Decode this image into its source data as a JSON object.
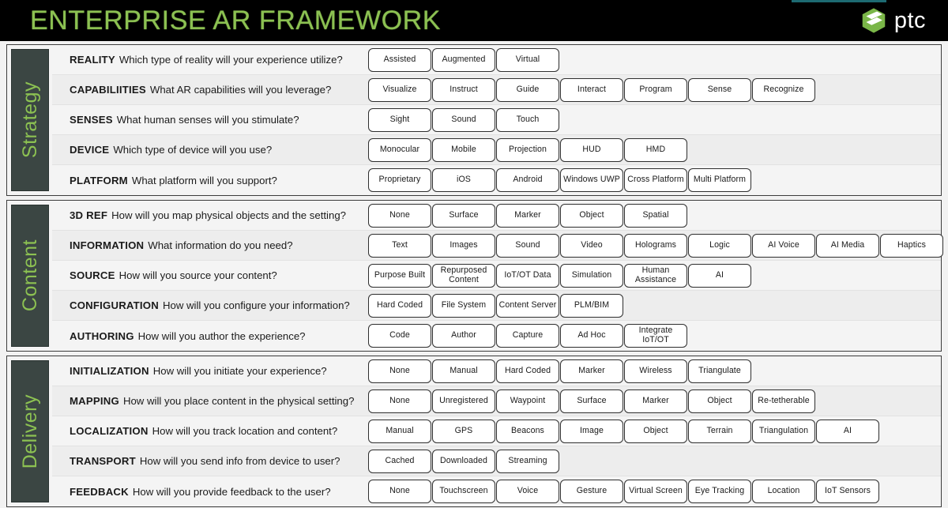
{
  "header": {
    "title": "ENTERPRISE AR FRAMEWORK",
    "brand_text": "ptc",
    "brand_icon": "ptc-hexagon-logo",
    "accent_green": "#8cc152",
    "accent_teal": "#1d6a72",
    "background": "#000000"
  },
  "sections": [
    {
      "label": "Strategy",
      "rows": [
        {
          "term": "REALITY",
          "question": "Which type of reality will your experience utilize?",
          "options": [
            "Assisted",
            "Augmented",
            "Virtual"
          ]
        },
        {
          "term": "CAPABILIITIES",
          "question": "What AR capabilities will you leverage?",
          "options": [
            "Visualize",
            "Instruct",
            "Guide",
            "Interact",
            "Program",
            "Sense",
            "Recognize"
          ]
        },
        {
          "term": "SENSES",
          "question": "What human senses will you stimulate?",
          "options": [
            "Sight",
            "Sound",
            "Touch"
          ]
        },
        {
          "term": "DEVICE",
          "question": "Which type of device will you use?",
          "options": [
            "Monocular",
            "Mobile",
            "Projection",
            "HUD",
            "HMD"
          ]
        },
        {
          "term": "PLATFORM",
          "question": "What platform will you support?",
          "options": [
            "Proprietary",
            "iOS",
            "Android",
            "Windows UWP",
            "Cross Platform",
            "Multi Platform"
          ]
        }
      ]
    },
    {
      "label": "Content",
      "rows": [
        {
          "term": "3D REF",
          "question": "How will you map physical objects and the setting?",
          "options": [
            "None",
            "Surface",
            "Marker",
            "Object",
            "Spatial"
          ]
        },
        {
          "term": "INFORMATION",
          "question": "What information do you need?",
          "options": [
            "Text",
            "Images",
            "Sound",
            "Video",
            "Holograms",
            "Logic",
            "AI Voice",
            "AI Media",
            "Haptics"
          ]
        },
        {
          "term": "SOURCE",
          "question": "How will you source your content?",
          "options": [
            "Purpose Built",
            "Repurposed Content",
            "IoT/OT Data",
            "Simulation",
            "Human Assistance",
            "AI"
          ]
        },
        {
          "term": "CONFIGURATION",
          "question": "How will you configure your information?",
          "options": [
            "Hard Coded",
            "File System",
            "Content Server",
            "PLM/BIM"
          ]
        },
        {
          "term": "AUTHORING",
          "question": "How will you author the experience?",
          "options": [
            "Code",
            "Author",
            "Capture",
            "Ad Hoc",
            "Integrate IoT/OT"
          ]
        }
      ]
    },
    {
      "label": "Delivery",
      "rows": [
        {
          "term": "INITIALIZATION",
          "question": "How will you initiate your experience?",
          "options": [
            "None",
            "Manual",
            "Hard Coded",
            "Marker",
            "Wireless",
            "Triangulate"
          ]
        },
        {
          "term": "MAPPING",
          "question": "How will you place content in the physical setting?",
          "options": [
            "None",
            "Unregistered",
            "Waypoint",
            "Surface",
            "Marker",
            "Object",
            "Re-tetherable"
          ]
        },
        {
          "term": "LOCALIZATION",
          "question": "How will you track location and content?",
          "options": [
            "Manual",
            "GPS",
            "Beacons",
            "Image",
            "Object",
            "Terrain",
            "Triangulation",
            "AI"
          ]
        },
        {
          "term": "TRANSPORT",
          "question": "How will you send info from device to user?",
          "options": [
            "Cached",
            "Downloaded",
            "Streaming"
          ]
        },
        {
          "term": "FEEDBACK",
          "question": "How will you provide feedback to the user?",
          "options": [
            "None",
            "Touchscreen",
            "Voice",
            "Gesture",
            "Virtual Screen",
            "Eye Tracking",
            "Location",
            "IoT Sensors"
          ]
        }
      ]
    }
  ]
}
